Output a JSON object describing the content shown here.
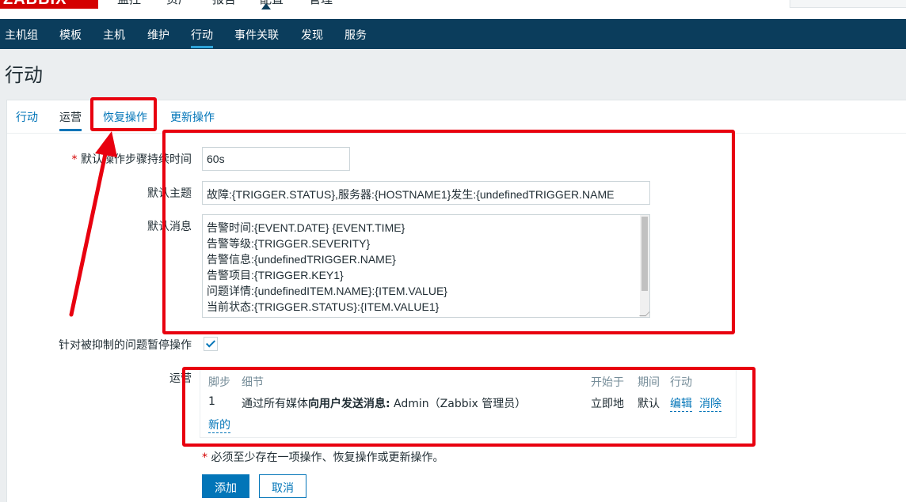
{
  "header": {
    "logo": "ZABBIX",
    "main_menu": [
      "监控",
      "资产",
      "报告",
      "配置",
      "管理"
    ]
  },
  "subnav": {
    "items": [
      "主机组",
      "模板",
      "主机",
      "维护",
      "行动",
      "事件关联",
      "发现",
      "服务"
    ],
    "active": "行动"
  },
  "page": {
    "title": "行动"
  },
  "tabs": {
    "items": [
      "行动",
      "运营",
      "恢复操作",
      "更新操作"
    ],
    "active": "运营"
  },
  "form": {
    "step_duration": {
      "label": "默认操作步骤持续时间",
      "required_mark": "*",
      "value": "60s"
    },
    "subject": {
      "label": "默认主题",
      "value": "故障:{TRIGGER.STATUS},服务器:{HOSTNAME1}发生:{undefinedTRIGGER.NAME"
    },
    "message": {
      "label": "默认消息",
      "lines": [
        "告警时间:{EVENT.DATE} {EVENT.TIME}",
        "告警等级:{TRIGGER.SEVERITY}",
        "告警信息:{undefinedTRIGGER.NAME}",
        "告警项目:{TRIGGER.KEY1}",
        "问题详情:{undefinedITEM.NAME}:{ITEM.VALUE}",
        "当前状态:{TRIGGER.STATUS}:{ITEM.VALUE1}"
      ]
    },
    "pause_suppressed": {
      "label": "针对被抑制的问题暂停操作",
      "checked": true
    },
    "operations": {
      "label": "运营",
      "columns": [
        "脚步",
        "细节",
        "开始于",
        "期间",
        "行动"
      ],
      "rows": [
        {
          "step": "1",
          "detail_prefix": "通过所有媒体",
          "detail_bold": "向用户发送消息:",
          "detail_suffix": " Admin（Zabbix 管理员）",
          "start": "立即地",
          "duration": "默认",
          "edit": "编辑",
          "remove": "消除"
        }
      ],
      "new_link": "新的"
    },
    "required_note": {
      "mark": "*",
      "text": " 必须至少存在一项操作、恢复操作或更新操作。"
    },
    "buttons": {
      "add": "添加",
      "cancel": "取消"
    }
  },
  "colors": {
    "nav_bg": "#0b3d5c",
    "accent": "#0275b8",
    "annotation": "#e8000f",
    "logo_bg": "#d40000"
  }
}
